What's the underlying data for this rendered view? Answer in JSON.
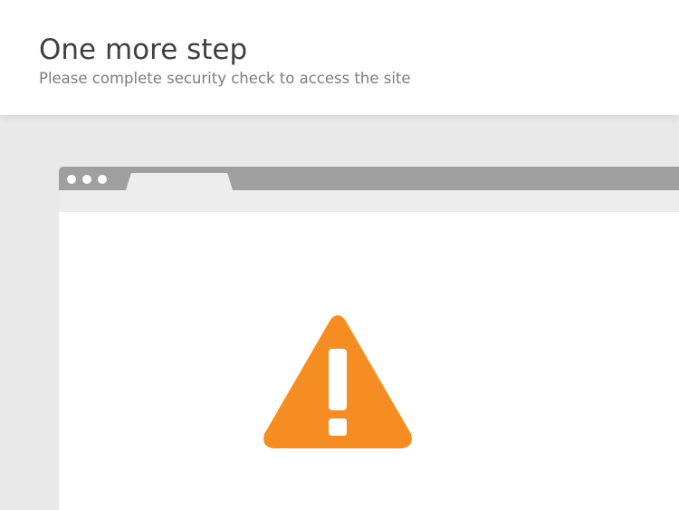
{
  "header": {
    "title": "One more step",
    "subtitle": "Please complete security check to access the site"
  },
  "colors": {
    "warning": "#f68d22",
    "bar": "#9f9f9f",
    "background": "#e9e9e9"
  },
  "icons": {
    "warning": "warning-icon",
    "window_dots": "window-dot-icon"
  }
}
